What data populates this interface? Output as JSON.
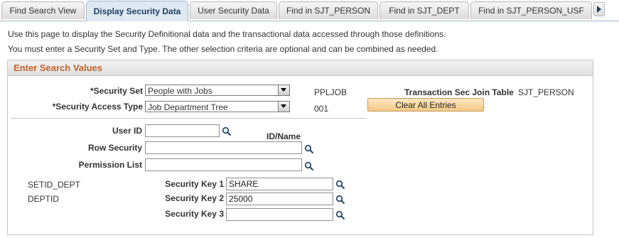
{
  "tabs": [
    {
      "label": "Find Search View"
    },
    {
      "label": "Display Security Data"
    },
    {
      "label": "User Security Data"
    },
    {
      "label": "Find in SJT_PERSON"
    },
    {
      "label": "Find in SJT_DEPT"
    },
    {
      "label": "Find in SJT_PERSON_USF"
    }
  ],
  "active_tab": "Display Security Data",
  "intro": {
    "line1": "Use this page to display the Security Definitional data and the transactional data accessed through those definitions.",
    "line2": "You must enter a Security Set and Type. The other selection criteria are optional and can be combined as needed."
  },
  "group": {
    "title": "Enter Search Values",
    "security_set": {
      "label": "*Security Set",
      "value": "People with Jobs",
      "code": "PPLJOB"
    },
    "security_access_type": {
      "label": "*Security Access Type",
      "value": "Job Department Tree",
      "code": "001"
    },
    "transaction_table": {
      "label": "Transaction Sec Join Table",
      "value": "SJT_PERSON"
    },
    "clear_button": "Clear All Entries",
    "user_id": {
      "label": "User ID",
      "value": ""
    },
    "id_name_label": "ID/Name",
    "row_security": {
      "label": "Row Security",
      "value": ""
    },
    "permission_list": {
      "label": "Permission List",
      "value": ""
    },
    "keys": [
      {
        "field": "SETID_DEPT",
        "label": "Security Key 1",
        "value": "SHARE"
      },
      {
        "field": "DEPTID",
        "label": "Security Key 2",
        "value": "25000"
      },
      {
        "field": "",
        "label": "Security Key 3",
        "value": ""
      }
    ]
  },
  "colors": {
    "accent": "#1f3f63",
    "header_text": "#c0642f",
    "button": "#f4c986"
  },
  "icons": {
    "lookup": "magnifier-icon",
    "dropdown": "chevron-down-icon",
    "scroll_tabs": "arrow-right-icon"
  }
}
